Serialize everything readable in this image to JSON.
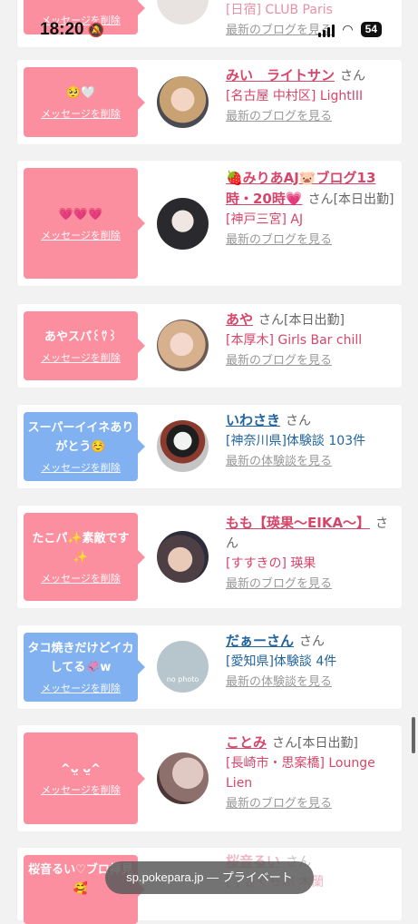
{
  "status_bar": {
    "time": "18:20",
    "battery": "54"
  },
  "top_partial": {
    "loc_text": "[日宿] CLUB Paris",
    "link_text": "最新のブログを見る",
    "del_text": "メッセージを削除"
  },
  "cards": [
    {
      "bubble_color": "pink",
      "message": "🥺🤍",
      "delete_label": "メッセージを削除",
      "name": "みい　ライトサン",
      "name_color": "pink",
      "san": "さん",
      "extra": "",
      "location": "[名古屋 中村区] LightIII",
      "link": "最新のブログを見る",
      "avatar_icon": "avatar-photo"
    },
    {
      "bubble_color": "pink",
      "message": "💗💗💗",
      "delete_label": "メッセージを削除",
      "name": "🍓みりあAJ🐷ブログ13時・20時💗",
      "name_color": "pink",
      "san": "さん",
      "extra": "[本日出勤]",
      "location": "[神戸三宮] AJ",
      "link": "最新のブログを見る",
      "avatar_icon": "avatar-photo"
    },
    {
      "bubble_color": "pink",
      "message": "あやスパ꒰⍢꒱",
      "delete_label": "メッセージを削除",
      "name": "あや",
      "name_color": "pink",
      "san": "さん",
      "extra": "[本日出勤]",
      "location": "[本厚木] Girls Bar chill",
      "link": "最新のブログを見る",
      "avatar_icon": "avatar-photo"
    },
    {
      "bubble_color": "blue",
      "message": "スーパーイイネありがとう☺️",
      "delete_label": "メッセージを削除",
      "name": "いわさき",
      "name_color": "blue",
      "san": "さん",
      "extra": "",
      "location": "[神奈川県]体験談 103件",
      "link": "最新の体験談を見る",
      "avatar_icon": "avatar-panda"
    },
    {
      "bubble_color": "pink",
      "message": "たこパ✨素敵です✨",
      "delete_label": "メッセージを削除",
      "name": "もも【瑛果〜EIKA〜】",
      "name_color": "pink",
      "san": "さん",
      "extra": "",
      "location": "[すすきの] 瑛果",
      "link": "最新のブログを見る",
      "avatar_icon": "avatar-photo"
    },
    {
      "bubble_color": "blue",
      "message": "タコ焼きだけどイカしてる🦑w",
      "delete_label": "メッセージを削除",
      "name": "だぁーさん",
      "name_color": "blue",
      "san": "さん",
      "extra": "",
      "location": "[愛知県]体験談 4件",
      "link": "最新の体験談を見る",
      "avatar_icon": "avatar-no-photo",
      "avatar_text": "no photo"
    },
    {
      "bubble_color": "pink",
      "message": "^ᴗ̤ ᴗ̤^",
      "delete_label": "メッセージを削除",
      "name": "ことみ",
      "name_color": "pink",
      "san": "さん",
      "extra": "[本日出勤]",
      "location": "[長崎市・思案橋] Lounge Lien",
      "link": "最新のブログを見る",
      "avatar_icon": "avatar-photo"
    }
  ],
  "bottom_partial": {
    "message": "桜音るい♡ブロ拝見🥰",
    "name": "桜音るい",
    "san": "さん",
    "location": "[ ] さくらぶ 木蘭"
  },
  "url_bar": {
    "text": "sp.pokepara.jp — プライベート"
  }
}
